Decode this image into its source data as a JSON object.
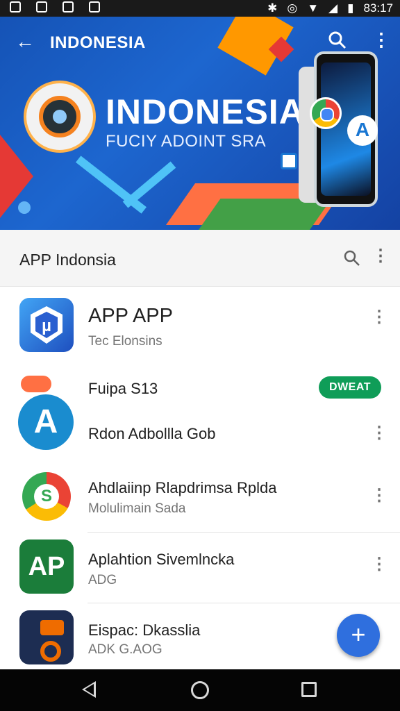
{
  "status_bar": {
    "time": "83:17"
  },
  "hero": {
    "header_title": "INDONESIA",
    "big_title": "INDONESIA",
    "subtitle": "FUCIY ADOINT SRA"
  },
  "app_bar": {
    "title": "APP Indonsia"
  },
  "apps": [
    {
      "title": "APP APP",
      "subtitle": "Tec Elonsins"
    },
    {
      "title": "Fuipa S13",
      "badge": "DWEAT"
    },
    {
      "title": "Rdon Adbollla Gob"
    },
    {
      "title": "Ahdlaiinp Rlapdrimsa Rplda",
      "subtitle": "Molulimain Sada"
    },
    {
      "title": "Aplahtion Sivemlncka",
      "subtitle": "ADG"
    },
    {
      "title": "Eispac: Dkasslia",
      "subtitle": "ADK G.AOG"
    }
  ],
  "fab": {
    "label": "+"
  },
  "icons": {
    "back": "arrow-left-icon",
    "search": "search-icon",
    "more": "more-vert-icon",
    "add": "plus-icon"
  },
  "colors": {
    "hero_blue": "#1d66cf",
    "badge_green": "#0f9d58",
    "fab_blue": "#2f6fde"
  }
}
